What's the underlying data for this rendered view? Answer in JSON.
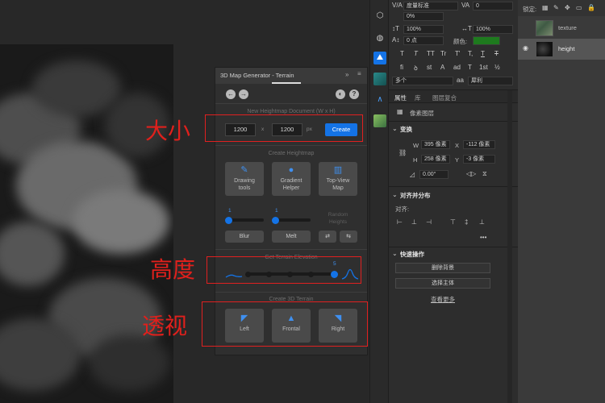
{
  "plugin": {
    "title": "3D Map Generator - Terrain",
    "collapse_glyph": "»",
    "menu_glyph": "≡",
    "back_glyph": "←",
    "forward_glyph": "→",
    "globe_glyph": "◐",
    "help_glyph": "?",
    "doc_section": {
      "title": "New Heightmap Document (W x H)",
      "width": "1200",
      "x_label": "x",
      "height": "1200",
      "unit": "px",
      "create_label": "Create"
    },
    "heightmap_section": {
      "title": "Create Heightmap",
      "tools": [
        {
          "label_line1": "Drawing",
          "label_line2": "tools",
          "icon": "brush-icon"
        },
        {
          "label_line1": "Gradient",
          "label_line2": "Helper",
          "icon": "drop-icon"
        },
        {
          "label_line1": "Top-View",
          "label_line2": "Map",
          "icon": "map-icon"
        }
      ],
      "blur_value": "1",
      "melt_value": "1",
      "blur_label": "Blur",
      "melt_label": "Melt",
      "random_label_line1": "Random",
      "random_label_line2": "Heights"
    },
    "elevation_section": {
      "title": "Get Terrain Elevation",
      "value": "5",
      "value_fraction": 1.0
    },
    "terrain_section": {
      "title": "Create 3D Terrain",
      "views": [
        "Left",
        "Frontal",
        "Right"
      ]
    }
  },
  "annotations": {
    "size_label": "大小",
    "height_label": "高度",
    "perspective_label": "透视"
  },
  "character": {
    "kerning_value": "度量标准",
    "tracking_value": "0",
    "baseline_value": "0%",
    "vertical_scale": "100%",
    "horizontal_scale": "100%",
    "baseline_shift": "0 点",
    "color_label": "颜色:",
    "color_value": "#1e7a1e",
    "style_glyphs": [
      "T",
      "T",
      "TT",
      "Tr",
      "T'",
      "T,",
      "T",
      "T"
    ],
    "opentype_glyphs": [
      "fi",
      "ꝺ",
      "st",
      "A",
      "ad",
      "T",
      "1st",
      "½"
    ],
    "language": "多个",
    "aa_label": "aa",
    "aa_value": "犀利"
  },
  "properties": {
    "tabs": [
      "属性",
      "库",
      "图层复合"
    ],
    "layer_kind": "像素图层",
    "transform_title": "变换",
    "w_label": "W",
    "w_value": "395 像素",
    "x_label": "X",
    "x_value": "-112 像素",
    "h_label": "H",
    "h_value": "258 像素",
    "y_label": "Y",
    "y_value": "-3 像素",
    "angle_value": "0.00°",
    "align_title": "对齐并分布",
    "align_label": "对齐:",
    "more_glyph": "•••",
    "quick_title": "快速操作",
    "remove_bg_label": "删除背景",
    "select_subject_label": "选择主体",
    "see_more_label": "查看更多"
  },
  "layers": {
    "lock_label": "锁定:",
    "items": [
      {
        "name": "texture"
      },
      {
        "name": "height"
      }
    ]
  }
}
